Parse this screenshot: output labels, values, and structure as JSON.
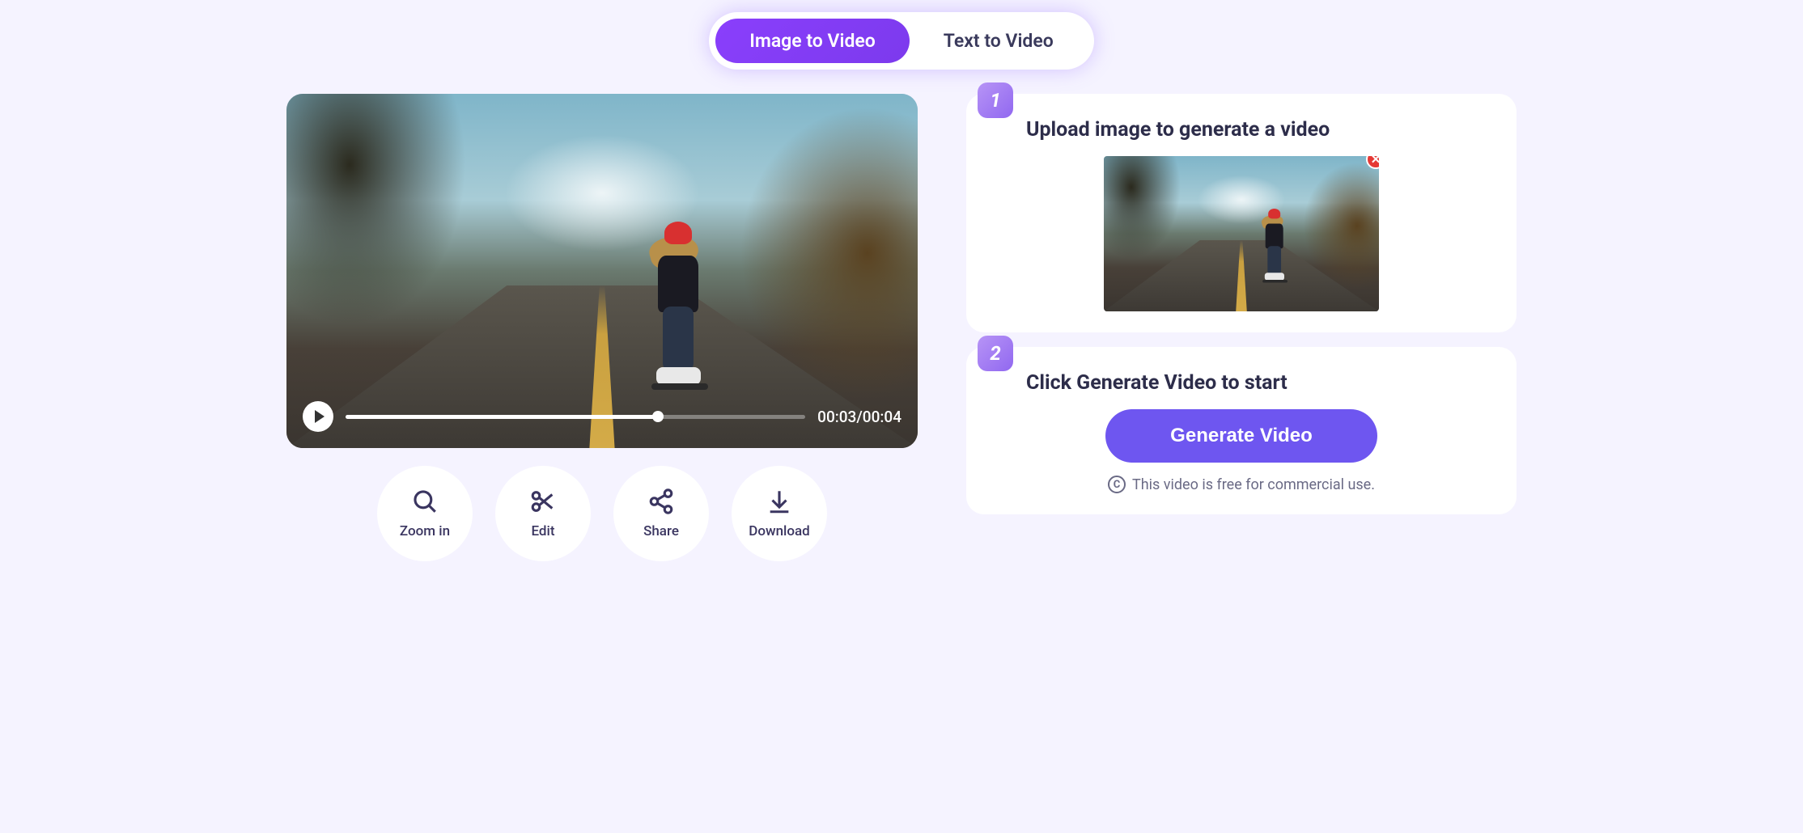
{
  "tabs": {
    "image_to_video": "Image to Video",
    "text_to_video": "Text to Video"
  },
  "video": {
    "current_time": "00:03",
    "total_time": "00:04",
    "progress_percent": 68
  },
  "actions": {
    "zoom": "Zoom in",
    "edit": "Edit",
    "share": "Share",
    "download": "Download"
  },
  "steps": {
    "one": {
      "num": "1",
      "title": "Upload image to generate a video"
    },
    "two": {
      "num": "2",
      "title": "Click Generate Video to start"
    }
  },
  "generate_label": "Generate Video",
  "disclaimer": "This video is free for commercial use.",
  "remove_glyph": "✕",
  "c_glyph": "C"
}
